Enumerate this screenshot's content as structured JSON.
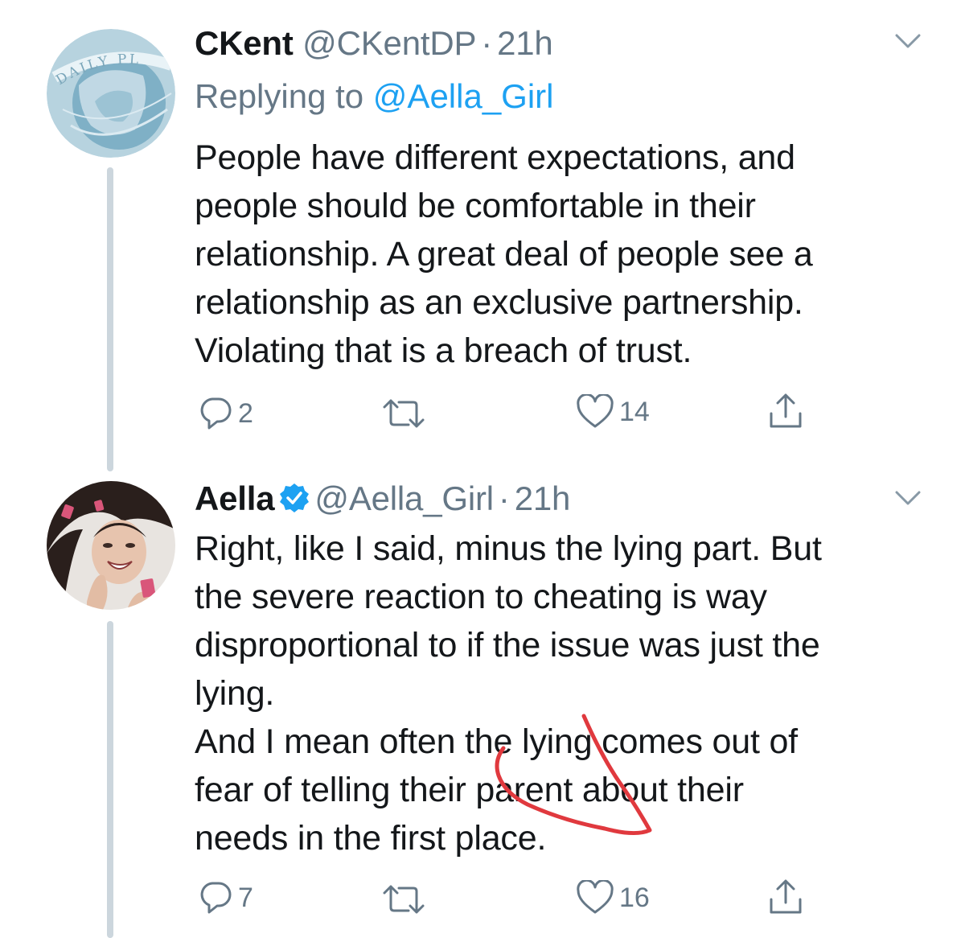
{
  "tweets": [
    {
      "display_name": "CKent",
      "handle": "@CKentDP",
      "separator": "·",
      "time": "21h",
      "replying_prefix": "Replying to ",
      "replying_handle": "@Aella_Girl",
      "text": "People have different expectations, and\npeople should be comfortable in their\nrelationship.  A great deal of people see a\nrelationship as an exclusive partnership.\nViolating that is a breach of trust.",
      "replies": "2",
      "likes": "14",
      "avatar_text": "DAILY PL"
    },
    {
      "display_name": "Aella",
      "verified": true,
      "handle": "@Aella_Girl",
      "separator": "·",
      "time": "21h",
      "text": "Right, like I said, minus the lying part. But\nthe severe reaction to cheating is way\ndisproportional to if the issue was just the\nlying.\nAnd I mean often the lying comes out of\nfear of telling their parent about their\nneeds in the first place.",
      "replies": "7",
      "likes": "16"
    }
  ],
  "colors": {
    "text": "#14171a",
    "secondary": "#657786",
    "link": "#1da1f2",
    "thread_line": "#ccd6dd",
    "annotation": "#e0393e"
  },
  "icons": [
    "chevron-down-icon",
    "reply-icon",
    "retweet-icon",
    "like-icon",
    "share-icon",
    "verified-badge-icon"
  ]
}
